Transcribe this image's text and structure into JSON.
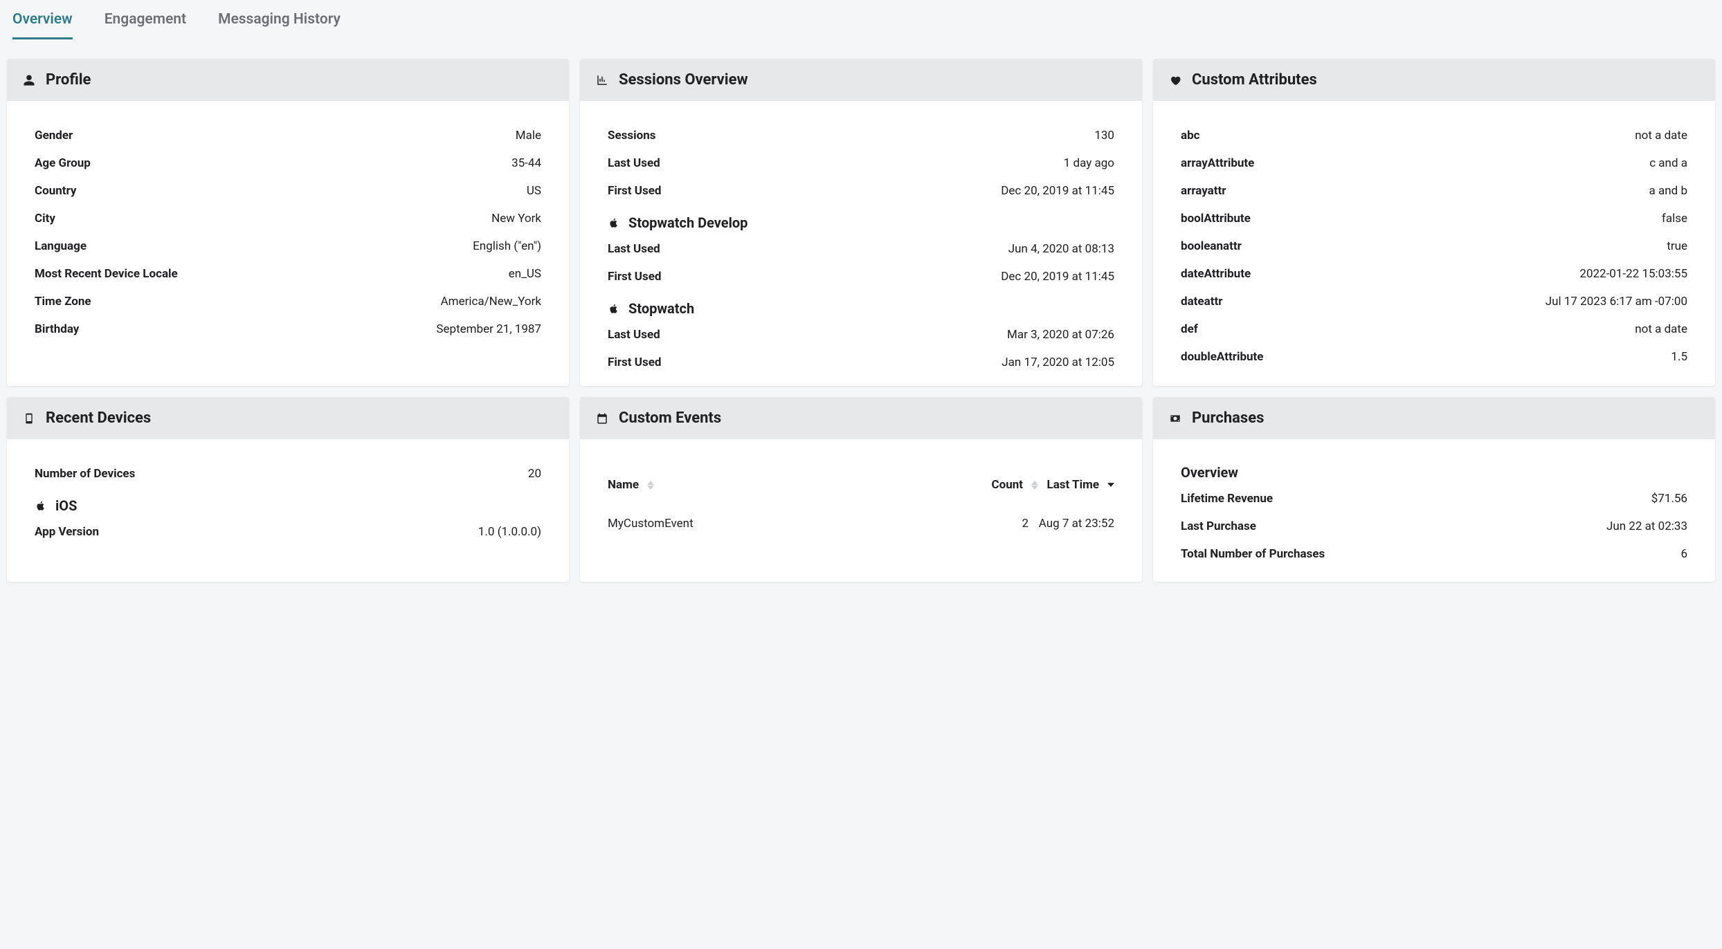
{
  "tabs": {
    "overview": "Overview",
    "engagement": "Engagement",
    "messaging": "Messaging History"
  },
  "profile": {
    "title": "Profile",
    "rows": [
      {
        "k": "Gender",
        "v": "Male"
      },
      {
        "k": "Age Group",
        "v": "35-44"
      },
      {
        "k": "Country",
        "v": "US"
      },
      {
        "k": "City",
        "v": "New York"
      },
      {
        "k": "Language",
        "v": "English (\"en\")"
      },
      {
        "k": "Most Recent Device Locale",
        "v": "en_US"
      },
      {
        "k": "Time Zone",
        "v": "America/New_York"
      },
      {
        "k": "Birthday",
        "v": "September 21, 1987"
      }
    ]
  },
  "sessions": {
    "title": "Sessions Overview",
    "top": [
      {
        "k": "Sessions",
        "v": "130"
      },
      {
        "k": "Last Used",
        "v": "1 day ago"
      },
      {
        "k": "First Used",
        "v": "Dec 20, 2019 at 11:45"
      }
    ],
    "apps": [
      {
        "name": "Stopwatch Develop",
        "rows": [
          {
            "k": "Last Used",
            "v": "Jun 4, 2020 at 08:13"
          },
          {
            "k": "First Used",
            "v": "Dec 20, 2019 at 11:45"
          }
        ]
      },
      {
        "name": "Stopwatch",
        "rows": [
          {
            "k": "Last Used",
            "v": "Mar 3, 2020 at 07:26"
          },
          {
            "k": "First Used",
            "v": "Jan 17, 2020 at 12:05"
          }
        ]
      }
    ]
  },
  "custom_attributes": {
    "title": "Custom Attributes",
    "rows": [
      {
        "k": "abc",
        "v": "not a date"
      },
      {
        "k": "arrayAttribute",
        "v": "c and a"
      },
      {
        "k": "arrayattr",
        "v": "a and b"
      },
      {
        "k": "boolAttribute",
        "v": "false"
      },
      {
        "k": "booleanattr",
        "v": "true"
      },
      {
        "k": "dateAttribute",
        "v": "2022-01-22 15:03:55"
      },
      {
        "k": "dateattr",
        "v": "Jul 17 2023 6:17 am -07:00"
      },
      {
        "k": "def",
        "v": "not a date"
      },
      {
        "k": "doubleAttribute",
        "v": "1.5"
      }
    ]
  },
  "recent_devices": {
    "title": "Recent Devices",
    "count_row": {
      "k": "Number of Devices",
      "v": "20"
    },
    "device": {
      "name": "iOS",
      "rows": [
        {
          "k": "App Version",
          "v": "1.0 (1.0.0.0)"
        }
      ]
    }
  },
  "custom_events": {
    "title": "Custom Events",
    "columns": {
      "name": "Name",
      "count": "Count",
      "last": "Last Time"
    },
    "rows": [
      {
        "name": "MyCustomEvent",
        "count": "2",
        "last": "Aug 7 at 23:52"
      }
    ]
  },
  "purchases": {
    "title": "Purchases",
    "overview_label": "Overview",
    "rows": [
      {
        "k": "Lifetime Revenue",
        "v": "$71.56"
      },
      {
        "k": "Last Purchase",
        "v": "Jun 22 at 02:33"
      },
      {
        "k": "Total Number of Purchases",
        "v": "6"
      }
    ]
  }
}
